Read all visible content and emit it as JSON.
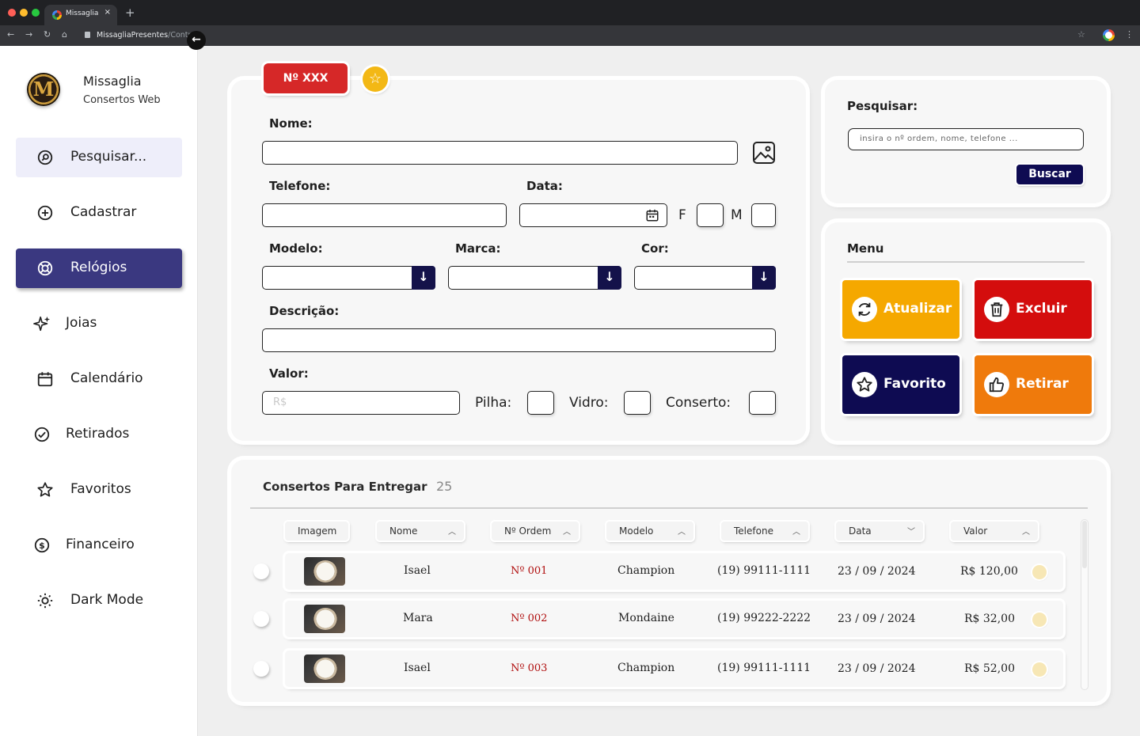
{
  "browser": {
    "tab_title": "Missaglia",
    "tab_close": "×",
    "new_tab": "+",
    "url_host": "MissagliaPresentes",
    "url_path": "/Controle"
  },
  "sidebar": {
    "brand_name": "Missaglia",
    "brand_sub": "Consertos Web",
    "logo_letter": "M",
    "collapse_icon": "←",
    "items": [
      {
        "label": "Pesquisar...",
        "icon": "search-icon"
      },
      {
        "label": "Cadastrar",
        "icon": "plus-circle-icon"
      },
      {
        "label": "Relógios",
        "icon": "watch-icon"
      },
      {
        "label": "Joias",
        "icon": "sparkles-icon"
      },
      {
        "label": "Calendário",
        "icon": "calendar-icon"
      },
      {
        "label": "Retirados",
        "icon": "check-circle-icon"
      },
      {
        "label": "Favoritos",
        "icon": "star-icon"
      },
      {
        "label": "Financeiro",
        "icon": "dollar-circle-icon"
      },
      {
        "label": "Dark Mode",
        "icon": "sun-icon"
      }
    ]
  },
  "form": {
    "order_badge": "Nº XXX",
    "nome_label": "Nome:",
    "telefone_label": "Telefone:",
    "data_label": "Data:",
    "f_label": "F",
    "m_label": "M",
    "modelo_label": "Modelo:",
    "marca_label": "Marca:",
    "cor_label": "Cor:",
    "descricao_label": "Descrição:",
    "valor_label": "Valor:",
    "valor_placeholder": "R$",
    "pilha_label": "Pilha:",
    "vidro_label": "Vidro:",
    "conserto_label": "Conserto:"
  },
  "search": {
    "label": "Pesquisar:",
    "placeholder": "insira o nº ordem, nome, telefone ...",
    "button": "Buscar"
  },
  "menu": {
    "title": "Menu",
    "buttons": [
      {
        "label": "Atualizar",
        "color": "#f5a800",
        "icon": "refresh-icon"
      },
      {
        "label": "Excluir",
        "color": "#d40d0d",
        "icon": "trash-icon"
      },
      {
        "label": "Favorito",
        "color": "#0e0b52",
        "icon": "star-icon"
      },
      {
        "label": "Retirar",
        "color": "#ef7a0c",
        "icon": "thumbs-up-icon"
      }
    ]
  },
  "table": {
    "title": "Consertos Para Entregar",
    "count": "25",
    "columns": [
      "Imagem",
      "Nome",
      "Nº Ordem",
      "Modelo",
      "Telefone",
      "Data",
      "Valor"
    ],
    "rows": [
      {
        "nome": "Isael",
        "ordem": "Nº 001",
        "modelo": "Champion",
        "telefone": "(19) 99111-1111",
        "data": "23 / 09 / 2024",
        "valor": "R$ 120,00"
      },
      {
        "nome": "Mara",
        "ordem": "Nº 002",
        "modelo": "Mondaine",
        "telefone": "(19) 99222-2222",
        "data": "23 / 09 / 2024",
        "valor": "R$ 32,00"
      },
      {
        "nome": "Isael",
        "ordem": "Nº 003",
        "modelo": "Champion",
        "telefone": "(19) 99111-1111",
        "data": "23 / 09 / 2024",
        "valor": "R$ 52,00"
      }
    ]
  }
}
